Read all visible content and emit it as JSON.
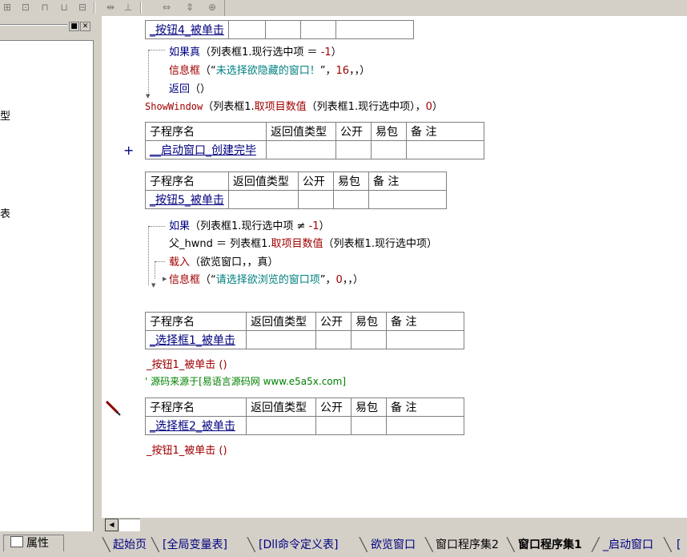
{
  "left_panel": {
    "fragments": [
      "型",
      "表"
    ],
    "tab_label": "属性"
  },
  "editor": {
    "block1": {
      "sub_name": "_按钮4_被单击",
      "lines": {
        "if_kw": "如果真",
        "if_args": "（列表框1.现行选中项 ＝ ",
        "if_num": "-1",
        "if_close": "）",
        "msg_kw": "信息框",
        "msg_open": "（“",
        "msg_str": "未选择欲隐藏的窗口！",
        "msg_mid": "”，",
        "msg_num": "16",
        "msg_end": "，，）",
        "ret_kw": "返回",
        "ret_args": "（）",
        "show_kw": "ShowWindow",
        "show_args1": "（列表框1.",
        "show_kw2": "取项目数值",
        "show_args2": "（列表框1.现行选中项），",
        "show_num": "0",
        "show_close": "）"
      }
    },
    "block2": {
      "headers": [
        "子程序名",
        "返回值类型",
        "公开",
        "易包",
        "备 注"
      ],
      "sub_name": "__启动窗口_创建完毕",
      "expand": "+"
    },
    "block3": {
      "headers": [
        "子程序名",
        "返回值类型",
        "公开",
        "易包",
        "备 注"
      ],
      "sub_name": "_按钮5_被单击",
      "lines": {
        "if_kw": "如果",
        "if_args": "（列表框1.现行选中项 ≠ ",
        "if_num": "-1",
        "if_close": "）",
        "assign": "父_hwnd ＝ 列表框1.",
        "assign_kw": "取项目数值",
        "assign_args": "（列表框1.现行选中项）",
        "load_kw": "载入",
        "load_args": "（欲览窗口，，真）",
        "msg_kw": "信息框",
        "msg_open": "（“",
        "msg_str": "请选择欲浏览的窗口项",
        "msg_mid": "”，",
        "msg_num": "0",
        "msg_end": "，，）"
      }
    },
    "block4": {
      "headers": [
        "子程序名",
        "返回值类型",
        "公开",
        "易包",
        "备 注"
      ],
      "sub_name": "_选择框1_被单击",
      "call": "_按钮1_被单击 ()",
      "comment": "' 源码来源于[易语言源码网 www.e5a5x.com]"
    },
    "block5": {
      "headers": [
        "子程序名",
        "返回值类型",
        "公开",
        "易包",
        "备 注"
      ],
      "sub_name": "_选择框2_被单击",
      "call": "_按钮1_被单击 ()"
    }
  },
  "scrollbar": {
    "left_arrow": "◀"
  },
  "bottom_tabs": [
    {
      "label": "起始页",
      "active": false
    },
    {
      "label": "[全局变量表]",
      "active": false
    },
    {
      "label": "[Dll命令定义表]",
      "active": false
    },
    {
      "label": "欲览窗口",
      "active": false
    },
    {
      "label": "窗口程序集2",
      "active": false
    },
    {
      "label": "窗口程序集1",
      "active": true
    },
    {
      "label": "_启动窗口",
      "active": false
    },
    {
      "label": "[",
      "active": false
    }
  ],
  "toolbar": {
    "icons": [
      "align-left-icon",
      "align-center-icon",
      "align-top-icon",
      "align-bottom-icon",
      "same-width-icon",
      "same-height-icon",
      "same-size-icon",
      "center-h-icon",
      "center-v-icon",
      "center-both-icon"
    ]
  },
  "colors": {
    "background": "#d4d0c8",
    "editor": "#ffffff",
    "keyword": "#a00000",
    "sub_name": "#00007f",
    "string": "#008080",
    "comment": "#008000"
  }
}
